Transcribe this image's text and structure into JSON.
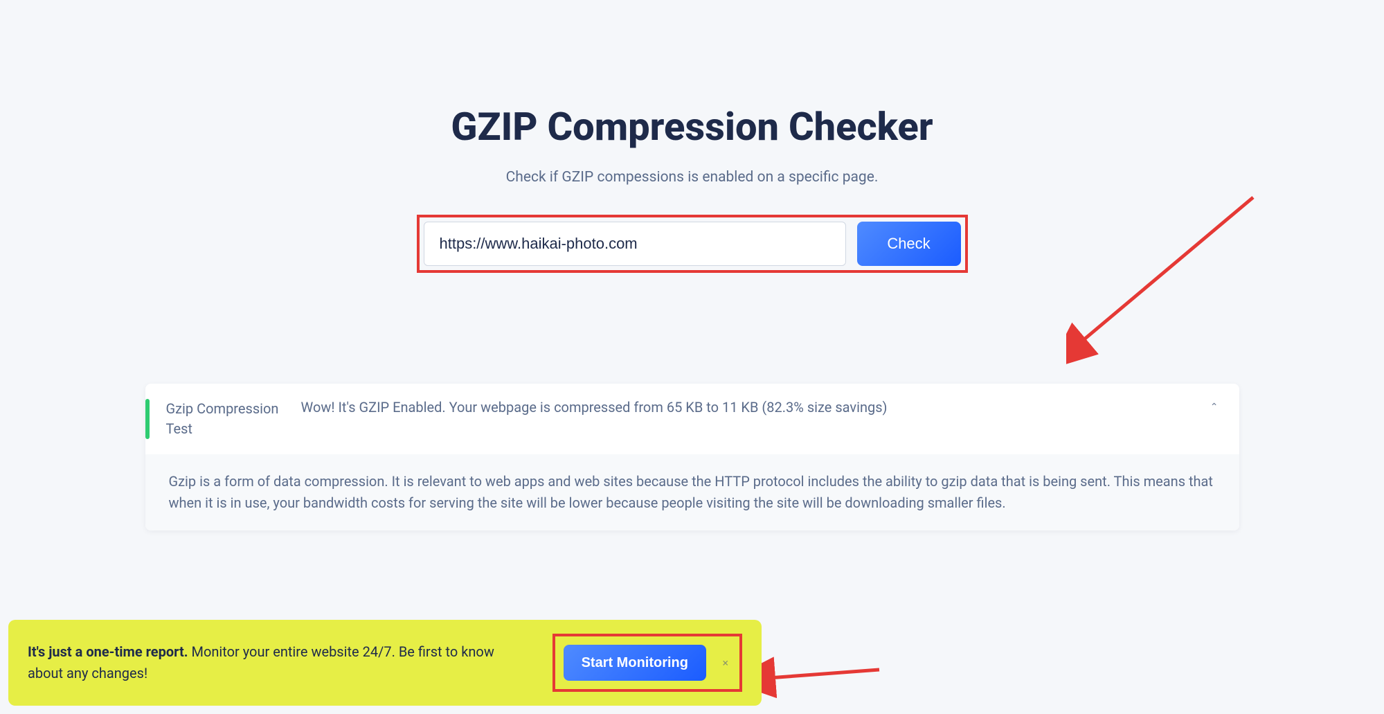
{
  "header": {
    "title": "GZIP Compression Checker",
    "subtitle": "Check if GZIP compessions is enabled on a specific page."
  },
  "search": {
    "url_value": "https://www.haikai-photo.com",
    "check_label": "Check"
  },
  "result": {
    "test_name": "Gzip Compression Test",
    "message": "Wow! It's GZIP Enabled. Your webpage is compressed from 65 KB to 11 KB (82.3% size savings)",
    "description": "Gzip is a form of data compression. It is relevant to web apps and web sites because the HTTP protocol includes the ability to gzip data that is being sent. This means that when it is in use, your bandwidth costs for serving the site will be lower because people visiting the site will be downloading smaller files."
  },
  "banner": {
    "bold": "It's just a one-time report.",
    "rest": " Monitor your entire website 24/7. Be first to know about any changes!",
    "cta_label": "Start Monitoring",
    "close_glyph": "×"
  },
  "annotation": {
    "color": "#e53935"
  }
}
